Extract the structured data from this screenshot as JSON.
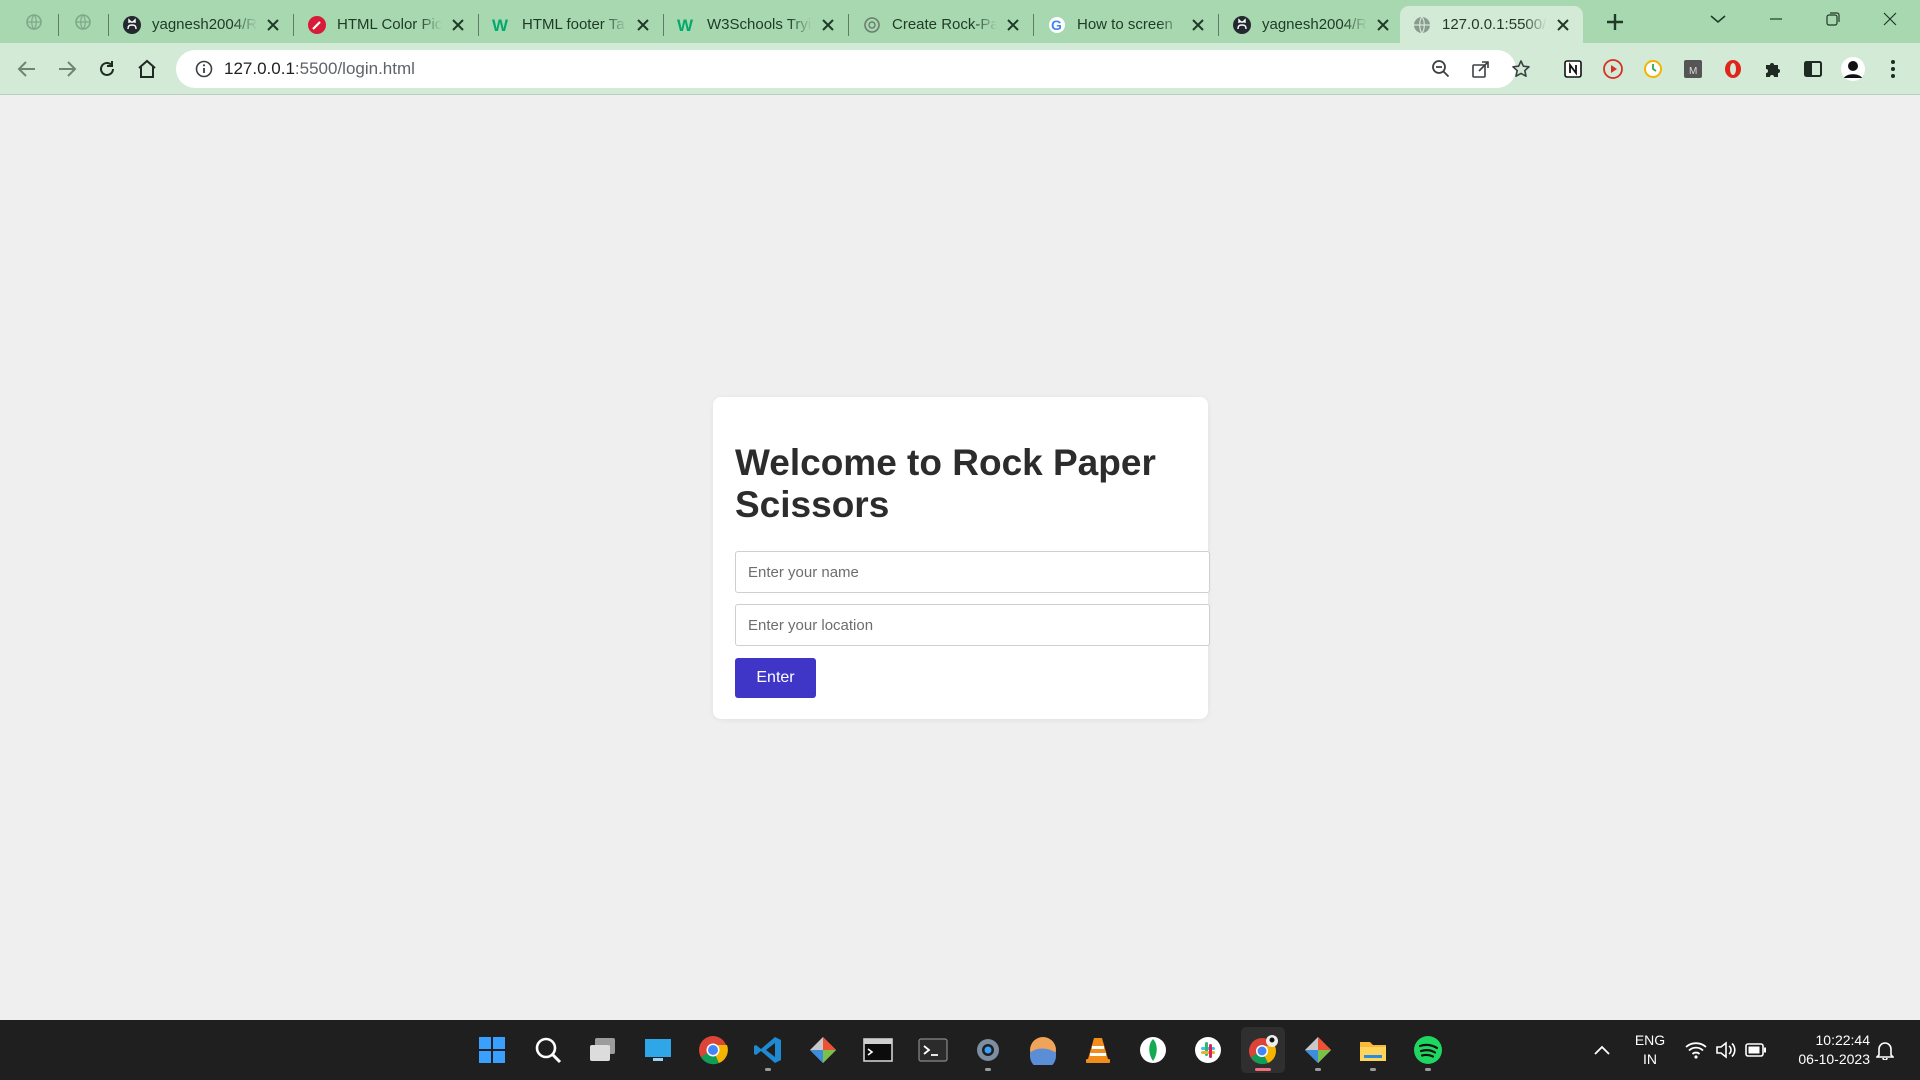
{
  "browser": {
    "tabs": [
      {
        "title": "yagnesh2004/R",
        "icon": "github-icon"
      },
      {
        "title": "HTML Color Pic",
        "icon": "color-picker-icon"
      },
      {
        "title": "HTML footer Ta",
        "icon": "w3schools-icon"
      },
      {
        "title": "W3Schools Tryi",
        "icon": "w3schools-icon"
      },
      {
        "title": "Create Rock-Pa",
        "icon": "openai-icon"
      },
      {
        "title": "How to screen",
        "icon": "google-icon"
      },
      {
        "title": "yagnesh2004/R",
        "icon": "github-icon"
      },
      {
        "title": "127.0.0.1:5500/",
        "icon": "globe-icon",
        "active": true
      }
    ],
    "url": {
      "host": "127.0.0.1",
      "path": ":5500/login.html"
    },
    "colors": {
      "tab_strip": "#a8d8b0",
      "toolbar": "#d2ead6"
    }
  },
  "page": {
    "heading": "Welcome to Rock Paper Scissors",
    "name_placeholder": "Enter your name",
    "location_placeholder": "Enter your location",
    "enter_label": "Enter",
    "colors": {
      "button": "#3f36c8",
      "background": "#efefef"
    }
  },
  "taskbar": {
    "apps": [
      "windows-start-icon",
      "search-icon",
      "task-view-icon",
      "desktop-icon",
      "chrome-icon",
      "vscode-icon",
      "git-icon",
      "terminal-icon",
      "windows-terminal-icon",
      "settings-icon",
      "photos-icon",
      "vlc-icon",
      "mongodb-icon",
      "slack-icon",
      "chrome-profile-icon",
      "git-gui-icon",
      "file-explorer-icon",
      "spotify-icon"
    ],
    "lang_1": "ENG",
    "lang_2": "IN",
    "time": "10:22:44",
    "date": "06-10-2023"
  }
}
